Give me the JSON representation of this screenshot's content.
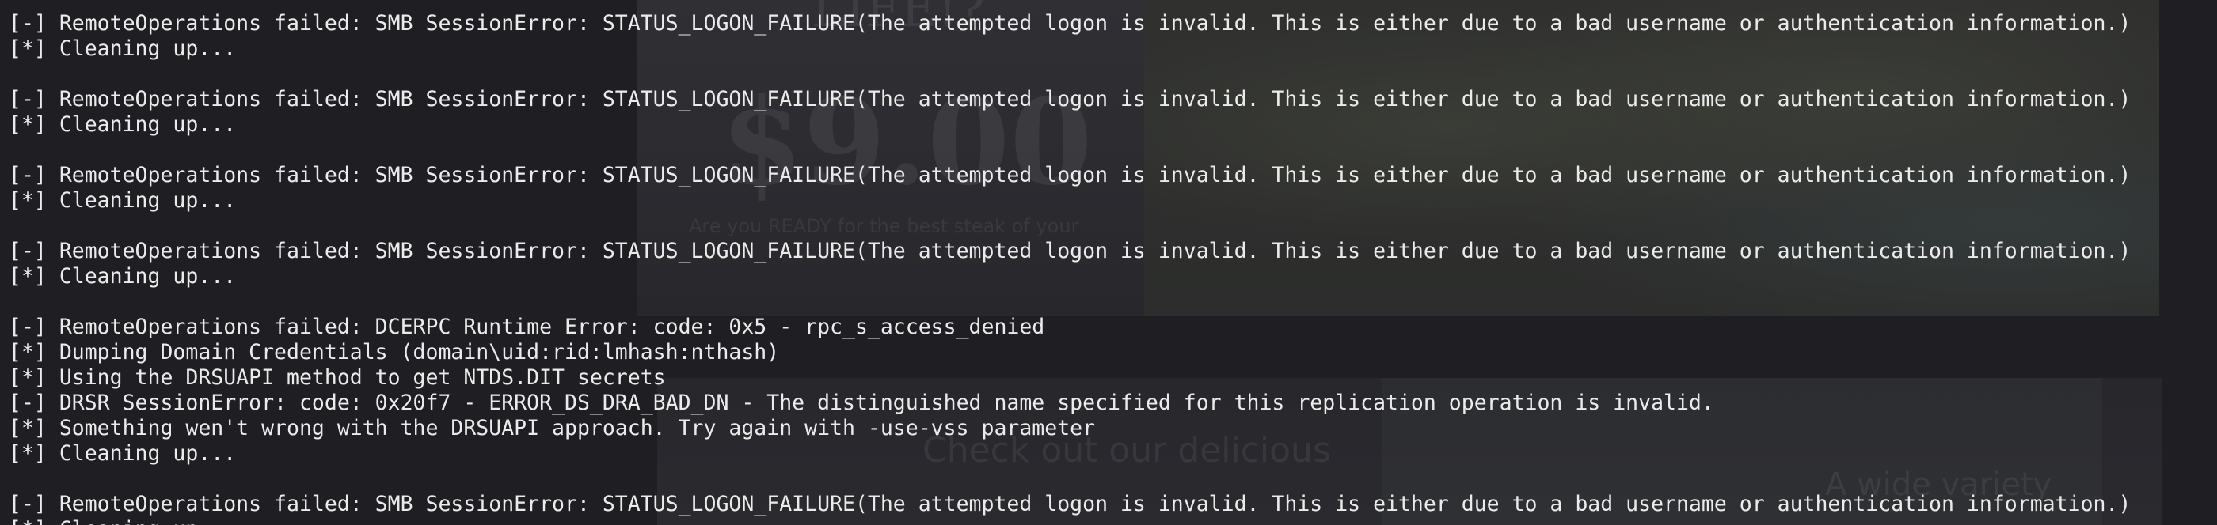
{
  "colors": {
    "background": "#1e1e23",
    "text": "#ebebeb"
  },
  "background_page": {
    "headline": "LIFE!?",
    "price": "$9.00",
    "tagline": "Are you READY for the best steak of your",
    "check_text": "Check out our delicious",
    "variety_text": "A wide variety"
  },
  "terminal": {
    "lines": [
      "[-] RemoteOperations failed: SMB SessionError: STATUS_LOGON_FAILURE(The attempted logon is invalid. This is either due to a bad username or authentication information.)",
      "[*] Cleaning up...",
      "",
      "[-] RemoteOperations failed: SMB SessionError: STATUS_LOGON_FAILURE(The attempted logon is invalid. This is either due to a bad username or authentication information.)",
      "[*] Cleaning up...",
      "",
      "[-] RemoteOperations failed: SMB SessionError: STATUS_LOGON_FAILURE(The attempted logon is invalid. This is either due to a bad username or authentication information.)",
      "[*] Cleaning up...",
      "",
      "[-] RemoteOperations failed: SMB SessionError: STATUS_LOGON_FAILURE(The attempted logon is invalid. This is either due to a bad username or authentication information.)",
      "[*] Cleaning up...",
      "",
      "[-] RemoteOperations failed: DCERPC Runtime Error: code: 0x5 - rpc_s_access_denied",
      "[*] Dumping Domain Credentials (domain\\uid:rid:lmhash:nthash)",
      "[*] Using the DRSUAPI method to get NTDS.DIT secrets",
      "[-] DRSR SessionError: code: 0x20f7 - ERROR_DS_DRA_BAD_DN - The distinguished name specified for this replication operation is invalid.",
      "[*] Something wen't wrong with the DRSUAPI approach. Try again with -use-vss parameter",
      "[*] Cleaning up...",
      "",
      "[-] RemoteOperations failed: SMB SessionError: STATUS_LOGON_FAILURE(The attempted logon is invalid. This is either due to a bad username or authentication information.)",
      "[*] Cleaning up..."
    ]
  }
}
